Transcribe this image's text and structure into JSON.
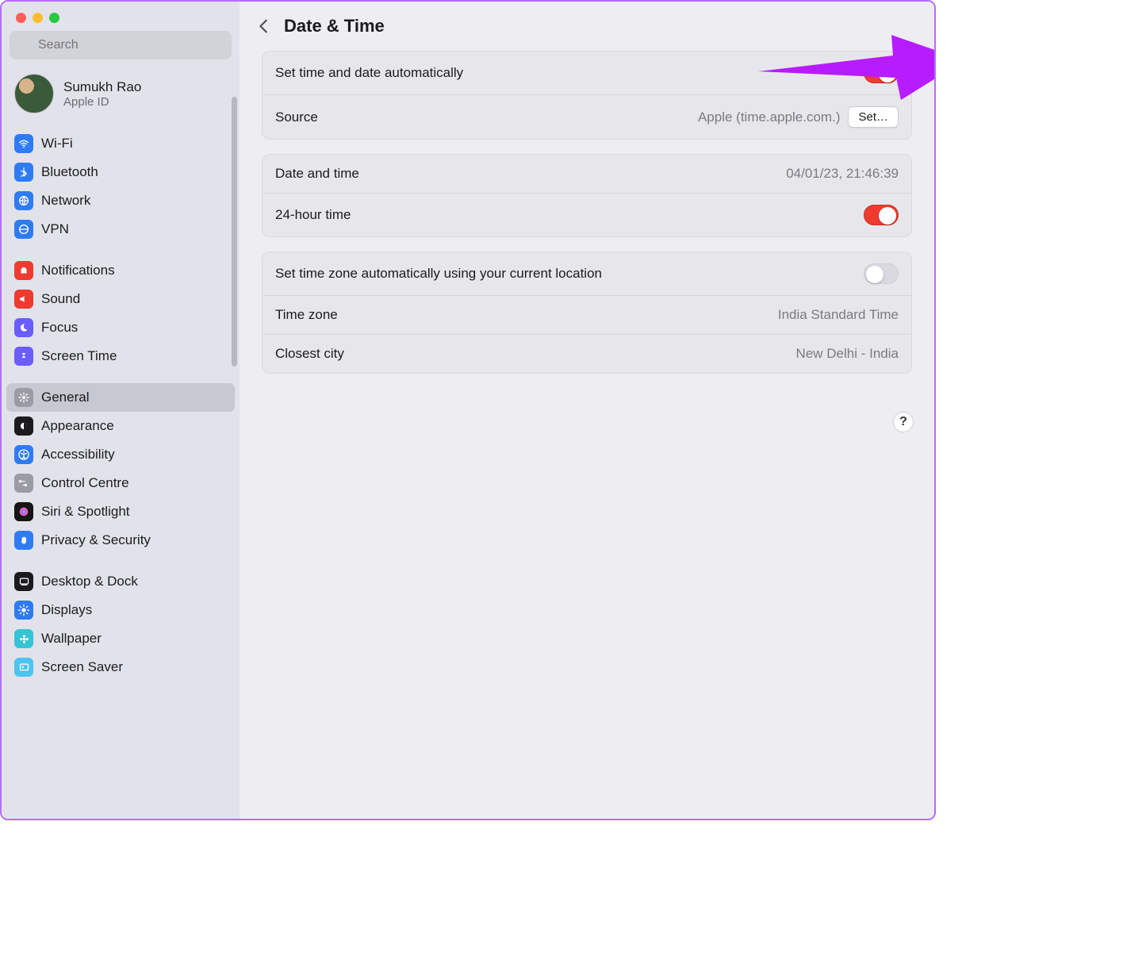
{
  "window": {
    "title": "Date & Time"
  },
  "search": {
    "placeholder": "Search"
  },
  "account": {
    "name": "Sumukh Rao",
    "sub": "Apple ID"
  },
  "sidebar": {
    "groups": [
      {
        "items": [
          {
            "label": "Wi-Fi",
            "icon_bg": "#2f7bf6",
            "glyph": "wifi"
          },
          {
            "label": "Bluetooth",
            "icon_bg": "#2f7bf6",
            "glyph": "bluetooth"
          },
          {
            "label": "Network",
            "icon_bg": "#2f7bf6",
            "glyph": "globe"
          },
          {
            "label": "VPN",
            "icon_bg": "#2f7bf6",
            "glyph": "vpn"
          }
        ]
      },
      {
        "items": [
          {
            "label": "Notifications",
            "icon_bg": "#ef3a2f",
            "glyph": "bell"
          },
          {
            "label": "Sound",
            "icon_bg": "#ef3a2f",
            "glyph": "speaker"
          },
          {
            "label": "Focus",
            "icon_bg": "#6a5cff",
            "glyph": "moon"
          },
          {
            "label": "Screen Time",
            "icon_bg": "#6a5cff",
            "glyph": "hourglass"
          }
        ]
      },
      {
        "items": [
          {
            "label": "General",
            "icon_bg": "#9b9ba3",
            "glyph": "gear",
            "selected": true
          },
          {
            "label": "Appearance",
            "icon_bg": "#1b1b1f",
            "glyph": "appearance"
          },
          {
            "label": "Accessibility",
            "icon_bg": "#2f7bf6",
            "glyph": "accessibility"
          },
          {
            "label": "Control Centre",
            "icon_bg": "#9b9ba3",
            "glyph": "control"
          },
          {
            "label": "Siri & Spotlight",
            "icon_bg": "#151515",
            "glyph": "siri"
          },
          {
            "label": "Privacy & Security",
            "icon_bg": "#2f7bf6",
            "glyph": "hand"
          }
        ]
      },
      {
        "items": [
          {
            "label": "Desktop & Dock",
            "icon_bg": "#1b1b1f",
            "glyph": "dock"
          },
          {
            "label": "Displays",
            "icon_bg": "#2f7bf6",
            "glyph": "sun"
          },
          {
            "label": "Wallpaper",
            "icon_bg": "#35c3d6",
            "glyph": "flower"
          },
          {
            "label": "Screen Saver",
            "icon_bg": "#4cc4f0",
            "glyph": "screensaver"
          }
        ]
      }
    ]
  },
  "panels": [
    {
      "rows": [
        {
          "label": "Set time and date automatically",
          "toggle": "on"
        },
        {
          "label": "Source",
          "value": "Apple (time.apple.com.)",
          "button": "Set…"
        }
      ]
    },
    {
      "rows": [
        {
          "label": "Date and time",
          "value": "04/01/23, 21:46:39"
        },
        {
          "label": "24-hour time",
          "toggle": "on"
        }
      ]
    },
    {
      "rows": [
        {
          "label": "Set time zone automatically using your current location",
          "toggle": "off"
        },
        {
          "label": "Time zone",
          "value": "India Standard Time"
        },
        {
          "label": "Closest city",
          "value": "New Delhi - India"
        }
      ]
    }
  ],
  "help": "?",
  "annotation_arrow_color": "#b61cff"
}
